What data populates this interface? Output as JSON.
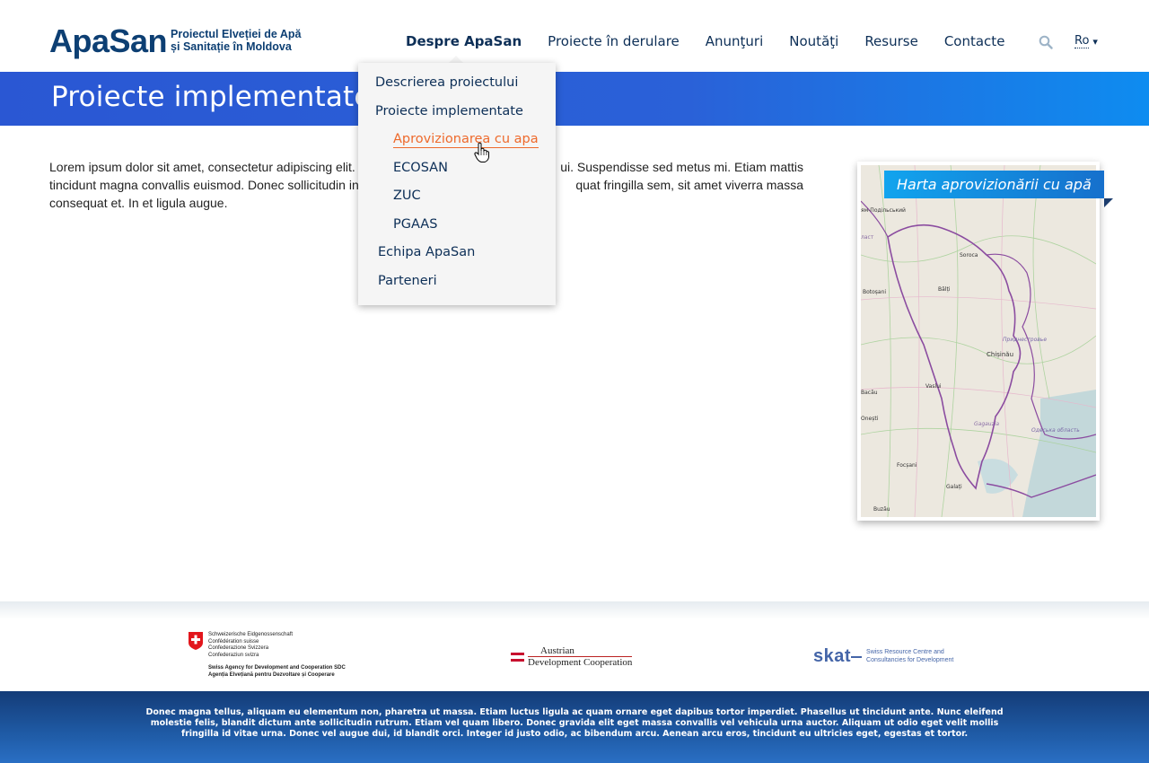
{
  "header": {
    "logo_main": "ApaSan",
    "logo_sub_line1": "Proiectul Elveției de Apă",
    "logo_sub_line2": "și Sanitație în Moldova",
    "nav": [
      {
        "label": "Despre ApaSan",
        "active": true
      },
      {
        "label": "Proiecte în derulare"
      },
      {
        "label": "Anunţuri"
      },
      {
        "label": "Noutăţi"
      },
      {
        "label": "Resurse"
      },
      {
        "label": "Contacte"
      }
    ],
    "search_icon": "search-icon",
    "language": "Ro",
    "language_caret": "▾"
  },
  "dropdown": {
    "items": [
      {
        "label": "Descrierea proiectului"
      },
      {
        "label": "Proiecte implementate"
      },
      {
        "label": "Aprovizionarea cu apa",
        "sub": true,
        "hover": true
      },
      {
        "label": "ECOSAN",
        "sub": true
      },
      {
        "label": "ZUC",
        "sub": true
      },
      {
        "label": "PGAAS",
        "sub": true
      },
      {
        "label": "Echipa ApaSan"
      },
      {
        "label": "Parteneri"
      }
    ]
  },
  "banner": {
    "title": "Proiecte implementate"
  },
  "content": {
    "paragraph": "Lorem ipsum dolor sit amet, consectetur adipiscing elit. Suspendisse sed metus mi. Etiam mattis tincidunt magna convallis euismod. Donec sollicitudin in quat fringilla sem, sit amet viverra massa consequat et. In et ligula augue."
  },
  "content_lines": {
    "l1a": "Lorem ipsum dolor sit amet, consectetur adipiscing elit.",
    "l1b": "ui. Suspendisse sed metus mi. Etiam mattis",
    "l2a": "tincidunt magna convallis euismod. Donec sollicitudin in",
    "l2b": "quat fringilla sem, sit amet viverra massa",
    "l3": "consequat et. In et ligula augue."
  },
  "map": {
    "label": "Harta aprovizionării cu apă",
    "places": [
      {
        "name": "Chișinău"
      },
      {
        "name": "Bălți"
      },
      {
        "name": "Soroca"
      },
      {
        "name": "Botoșani"
      },
      {
        "name": "Vaslui"
      },
      {
        "name": "Bacău"
      },
      {
        "name": "Onești"
      },
      {
        "name": "Focșani"
      },
      {
        "name": "Galați"
      },
      {
        "name": "Buzău"
      },
      {
        "name": "Gagauzia"
      },
      {
        "name": "Приднестровье"
      },
      {
        "name": "Одеська область"
      },
      {
        "name": "ям-Подільський"
      },
      {
        "name": "ласт"
      }
    ]
  },
  "partners": {
    "sdc_lines": [
      "Schweizerische Eidgenossenschaft",
      "Confédération suisse",
      "Confederazione Svizzera",
      "Confederaziun svizra"
    ],
    "sdc_bold1": "Swiss Agency for Development and Cooperation SDC",
    "sdc_bold2": "Agenția Elvețiană pentru Dezvoltare și Cooperare",
    "adc_line1": "Austrian",
    "adc_line2": "Development Cooperation",
    "skat_logo": "skat",
    "skat_line1": "Swiss Resource Centre and",
    "skat_line2": "Consultancies for Development"
  },
  "footer": {
    "text": "Donec magna tellus, aliquam eu elementum non, pharetra ut massa. Etiam luctus ligula ac quam ornare eget dapibus tortor imperdiet. Phasellus ut tincidunt ante. Nunc eleifend molestie felis, blandit dictum ante sollicitudin rutrum. Etiam vel quam libero. Donec gravida elit eget massa convallis vel vehicula urna auctor. Aliquam ut odio eget velit mollis fringilla id vitae urna. Donec vel augue dui, id blandit orci. Integer id justo odio, ac bibendum arcu. Aenean arcu eros, tincidunt eu ultricies eget, egestas et tortor."
  },
  "colors": {
    "brand_navy": "#0d3f73",
    "banner_blue": "#2a57d3",
    "hover_orange": "#ee6a2c",
    "footer_blue": "#1f5ba6"
  }
}
